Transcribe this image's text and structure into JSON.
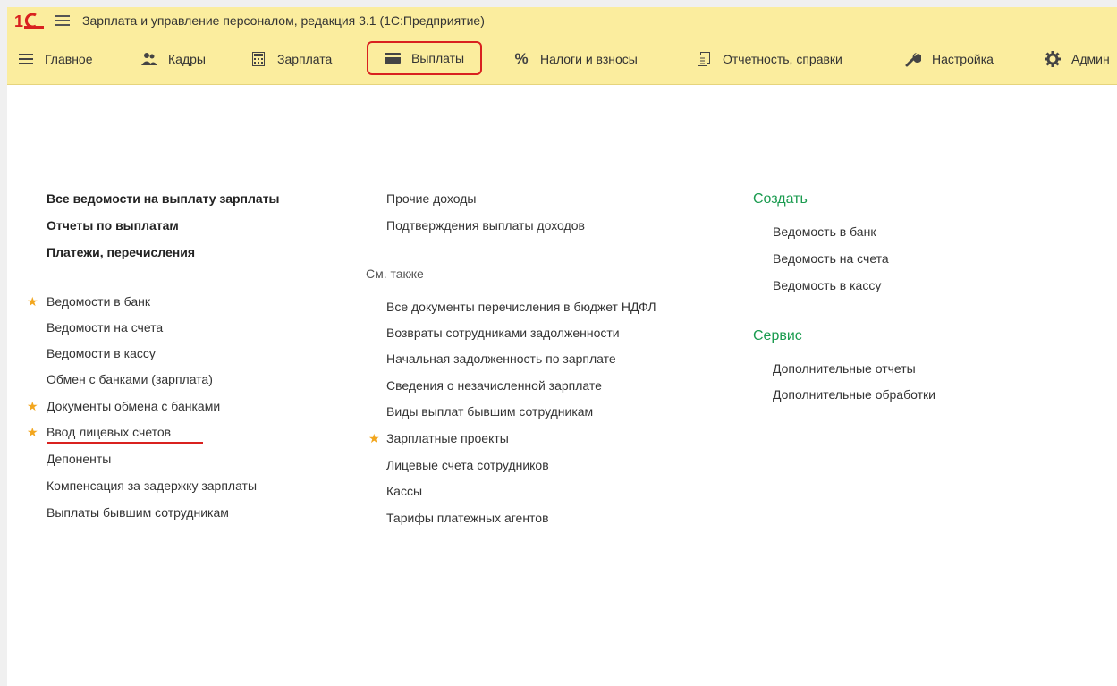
{
  "window": {
    "title": "Зарплата и управление персоналом, редакция 3.1  (1С:Предприятие)"
  },
  "sections": [
    {
      "label": "Главное",
      "icon": "hamburger-icon"
    },
    {
      "label": "Кадры",
      "icon": "people-icon"
    },
    {
      "label": "Зарплата",
      "icon": "calculator-icon"
    },
    {
      "label": "Выплаты",
      "icon": "wallet-icon",
      "active": true
    },
    {
      "label": "Налоги и взносы",
      "icon": "percent-icon"
    },
    {
      "label": "Отчетность, справки",
      "icon": "documents-icon"
    },
    {
      "label": "Настройка",
      "icon": "wrench-icon"
    },
    {
      "label": "Админ",
      "icon": "gear-icon"
    }
  ],
  "col1": {
    "bold_links": [
      "Все ведомости на выплату зарплаты",
      "Отчеты по выплатам",
      "Платежи, перечисления"
    ],
    "links": [
      {
        "label": "Ведомости в банк",
        "starred": true
      },
      {
        "label": "Ведомости на счета",
        "starred": false
      },
      {
        "label": "Ведомости в кассу",
        "starred": false
      },
      {
        "label": "Обмен с банками (зарплата)",
        "starred": false
      },
      {
        "label": "Документы обмена с банками",
        "starred": true
      },
      {
        "label": "Ввод лицевых счетов",
        "starred": true,
        "highlighted": true
      },
      {
        "label": "Депоненты",
        "starred": false
      },
      {
        "label": "Компенсация за задержку зарплаты",
        "starred": false
      },
      {
        "label": "Выплаты бывшим сотрудникам",
        "starred": false
      }
    ]
  },
  "col2": {
    "links_top": [
      "Прочие доходы",
      "Подтверждения выплаты доходов"
    ],
    "see_also_label": "См. также",
    "see_also": [
      {
        "label": "Все документы перечисления в бюджет НДФЛ",
        "starred": false
      },
      {
        "label": "Возвраты сотрудниками задолженности",
        "starred": false
      },
      {
        "label": "Начальная задолженность по зарплате",
        "starred": false
      },
      {
        "label": "Сведения о незачисленной зарплате",
        "starred": false
      },
      {
        "label": "Виды выплат бывшим сотрудникам",
        "starred": false
      },
      {
        "label": "Зарплатные проекты",
        "starred": true
      },
      {
        "label": "Лицевые счета сотрудников",
        "starred": false
      },
      {
        "label": "Кассы",
        "starred": false
      },
      {
        "label": "Тарифы платежных агентов",
        "starred": false
      }
    ]
  },
  "col3": {
    "create_heading": "Создать",
    "create_links": [
      "Ведомость в банк",
      "Ведомость на счета",
      "Ведомость в кассу"
    ],
    "service_heading": "Сервис",
    "service_links": [
      "Дополнительные отчеты",
      "Дополнительные обработки"
    ]
  },
  "colors": {
    "panel_bg": "#fbed9e",
    "accent_green": "#1a9b4f",
    "highlight_red": "#d9211f",
    "star": "#f2a61e"
  }
}
